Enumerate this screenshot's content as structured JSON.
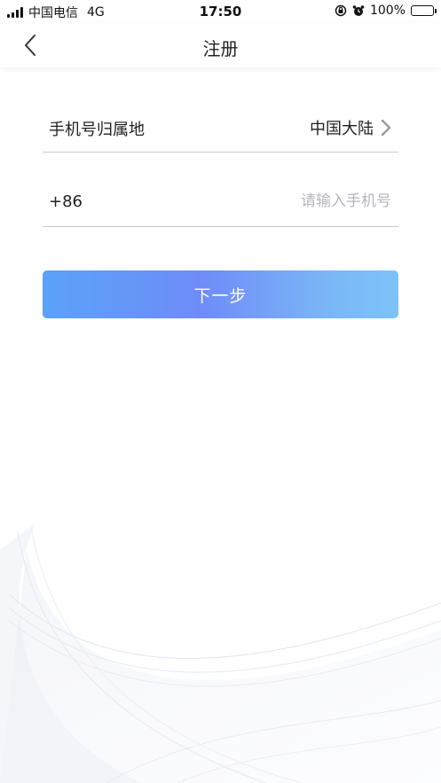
{
  "status_bar": {
    "carrier": "中国电信",
    "network": "4G",
    "time": "17:50",
    "battery": "100%"
  },
  "nav": {
    "title": "注册"
  },
  "form": {
    "region_label": "手机号归属地",
    "region_value": "中国大陆",
    "phone_prefix": "+86",
    "phone_value": "",
    "phone_placeholder": "请输入手机号"
  },
  "next_button": {
    "label": "下一步"
  },
  "colors": {
    "button_gradient": [
      "#5aa2f9",
      "#6f8cf8",
      "#7cc3f9"
    ],
    "divider": "#c9c9d4",
    "placeholder": "#b5b5bd"
  },
  "icons": [
    "back-arrow-icon",
    "chevron-right-icon",
    "signal-icon",
    "orientation-lock-icon",
    "alarm-icon",
    "battery-icon"
  ]
}
